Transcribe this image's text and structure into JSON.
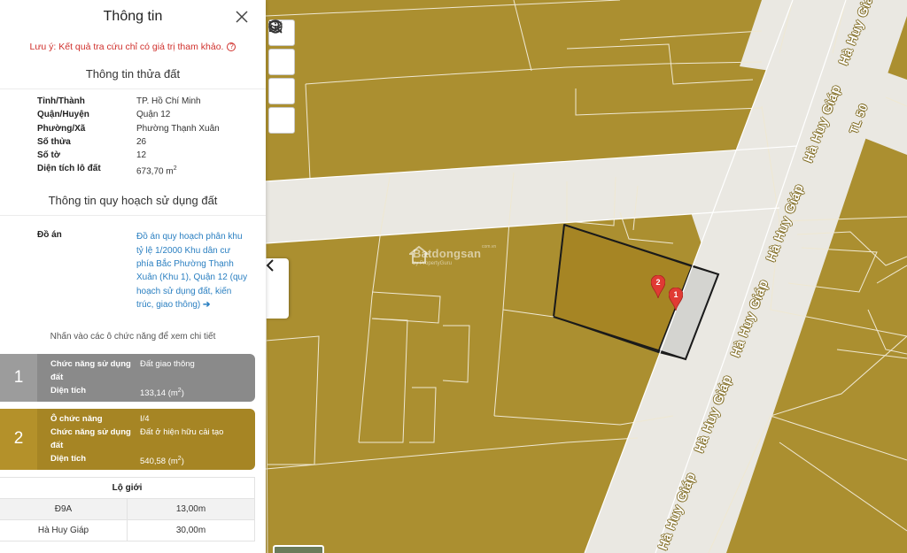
{
  "panel": {
    "title": "Thông tin",
    "notice": "Lưu ý: Kết quả tra cứu chỉ có giá trị tham khảo.",
    "parcel_section_title": "Thông tin thửa đất",
    "parcel_rows": [
      {
        "label": "Tỉnh/Thành",
        "value": "TP. Hồ Chí Minh"
      },
      {
        "label": "Quận/Huyện",
        "value": "Quận 12"
      },
      {
        "label": "Phường/Xã",
        "value": "Phường Thạnh Xuân"
      },
      {
        "label": "Số thửa",
        "value": "26"
      },
      {
        "label": "Số tờ",
        "value": "12"
      },
      {
        "label": "Diện tích lô đất",
        "value": "673,70 m",
        "unit_sup": "2"
      }
    ],
    "planning_section_title": "Thông tin quy hoạch sử dụng đất",
    "plan_label": "Đồ án",
    "plan_link": "Đồ án quy hoạch phân khu tỷ lệ 1/2000 Khu dân cư phía Bắc Phường Thạnh Xuân (Khu 1), Quận 12 (quy hoạch sử dụng đất, kiến trúc, giao thông)",
    "hint": "Nhấn vào các ô chức năng để xem chi tiết",
    "function_cards": [
      {
        "number": "1",
        "rows": [
          {
            "label": "Chức năng sử dụng đất",
            "value": "Đất giao thông"
          },
          {
            "label": "Diện tích",
            "value": "133,14 (m",
            "sup": "2",
            "close": ")"
          }
        ]
      },
      {
        "number": "2",
        "rows": [
          {
            "label": "Ô chức năng",
            "value": "I/4"
          },
          {
            "label": "Chức năng sử dụng đất",
            "value": "Đất ở hiện hữu cải tạo"
          },
          {
            "label": "Diện tích",
            "value": "540,58 (m",
            "sup": "2",
            "close": ")"
          }
        ]
      }
    ],
    "road_table": {
      "title": "Lộ giới",
      "rows": [
        {
          "name": "Đ9A",
          "width": "13,00m"
        },
        {
          "name": "Hà Huy Giáp",
          "width": "30,00m"
        }
      ]
    }
  },
  "map": {
    "watermark": {
      "name": "Batdongsan",
      "sub": "by PropertyGuru",
      "domain": "com.vn"
    },
    "road_labels": [
      "Hà Huy Giáp",
      "Hà Huy Giáp",
      "Hà Huy Giáp",
      "Hà Huy Giáp",
      "Hà Huy Giáp",
      "Hà Huy Giáp",
      "TL 50"
    ],
    "pins": [
      "2",
      "1"
    ],
    "tools": [
      "search-icon",
      "layers-icon",
      "legend-list-icon",
      "info-icon"
    ],
    "colors": {
      "residential": "#ab8f30",
      "road": "#eae8e2",
      "traffic_land": "#d4d4d0",
      "parcel_border": "#1a1a1a",
      "pin": "#e03b34"
    }
  }
}
